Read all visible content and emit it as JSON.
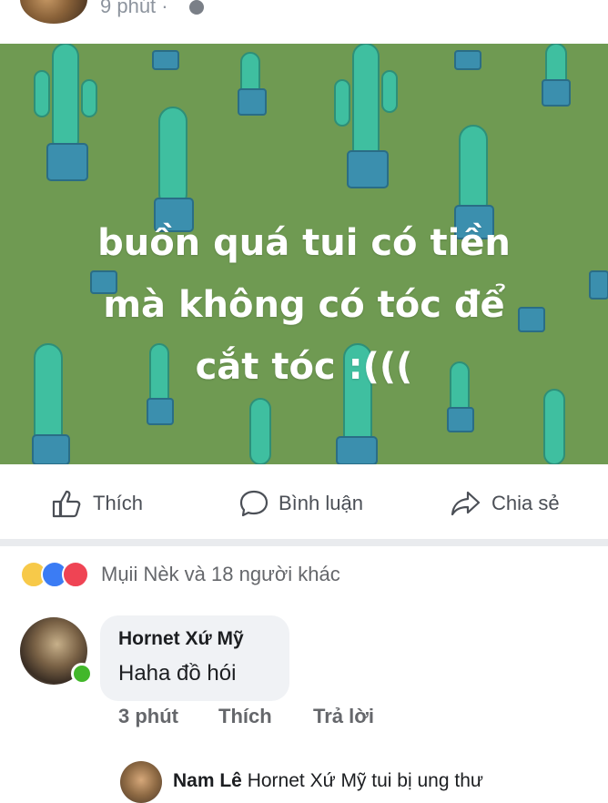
{
  "post": {
    "time": "9 phút ·",
    "privacy_icon": "globe-icon",
    "text_lines": [
      "buồn quá tui có tiền",
      "mà không có tóc để",
      "cắt tóc :((("
    ],
    "background_color": "#6f9a52"
  },
  "actions": {
    "like_label": "Thích",
    "comment_label": "Bình luận",
    "share_label": "Chia sẻ"
  },
  "reactions": {
    "icons": [
      "sad-reaction-icon",
      "like-reaction-icon",
      "love-reaction-icon"
    ],
    "summary": "Mụii Nèk và 18 người khác"
  },
  "comment": {
    "author": "Hornet Xứ Mỹ",
    "text": "Haha đồ hói",
    "time": "3 phút",
    "like_label": "Thích",
    "reply_label": "Trả lời"
  },
  "reply": {
    "author": "Nam Lê",
    "text": "Hornet Xứ Mỹ tui bị ung thư"
  }
}
